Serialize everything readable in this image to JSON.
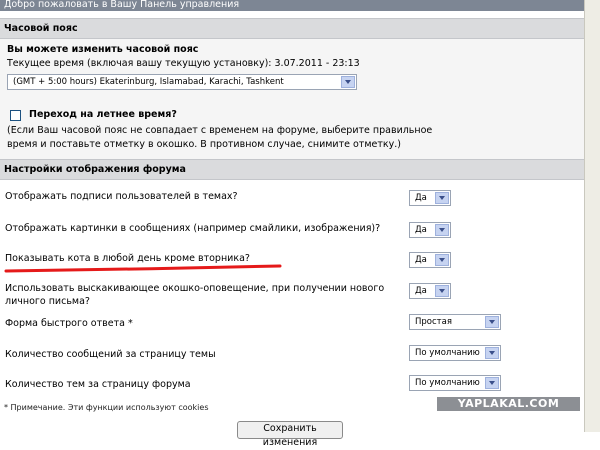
{
  "header": {
    "title": "Добро пожаловать в Вашу Панель управления"
  },
  "timezone": {
    "section_title": "Часовой пояс",
    "change_label": "Вы можете изменить часовой пояс",
    "current_time": "Текущее время (включая вашу текущую установку): 3.07.2011 - 23:13",
    "selected": "(GMT + 5:00 hours) Ekaterinburg, Islamabad, Karachi, Tashkent",
    "dst_label": "Переход на летнее время?",
    "dst_checked": false,
    "dst_help_line1": "(Если Ваш часовой пояс не совпадает с временем на форуме, выберите правильное",
    "dst_help_line2": "время и поставьте отметку в окошко. В противном случае, снимите отметку.)"
  },
  "display": {
    "section_title": "Настройки отображения форума",
    "rows": [
      {
        "label": "Отображать подписи пользователей в темах?",
        "value": "Да"
      },
      {
        "label": "Отображать картинки в сообщениях (например смайлики, изображения)?",
        "value": "Да"
      },
      {
        "label": "Показывать кота в любой день кроме вторника?",
        "value": "Да"
      },
      {
        "label_line1": "Использовать выскакивающее окошко-оповещение, при получении нового",
        "label_line2": "личного письма?",
        "value": "Да"
      },
      {
        "label": "Форма быстрого ответа *",
        "value": "Простая"
      },
      {
        "label": "Количество сообщений за страницу темы",
        "value": "По умолчанию"
      },
      {
        "label": "Количество тем за страницу форума",
        "value": "По умолчанию"
      }
    ],
    "note": "* Примечание. Эти функции используют cookies"
  },
  "submit_label": "Сохранить изменения",
  "watermark": "YAPLAKAL.COM",
  "colors": {
    "annotation_line": "#e51a1a",
    "section_header": "#dadbdd",
    "top_bar": "#7d8694"
  }
}
